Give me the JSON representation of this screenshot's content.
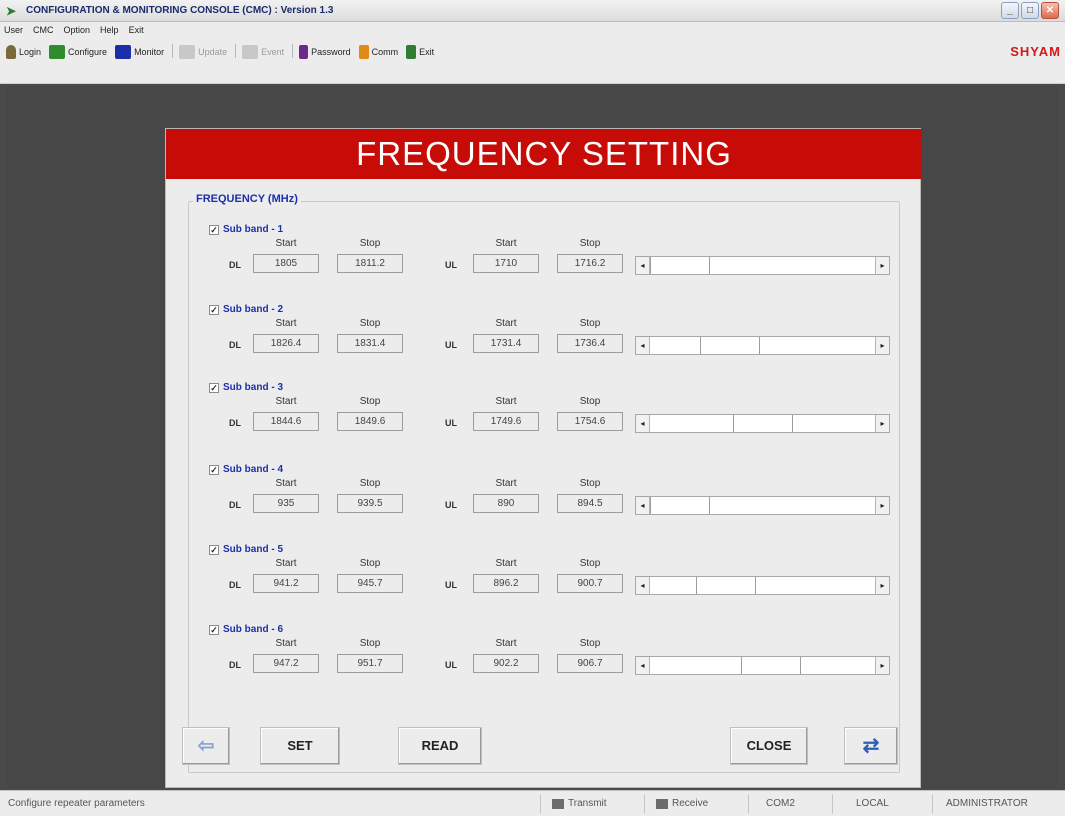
{
  "window": {
    "title": "CONFIGURATION & MONITORING CONSOLE (CMC) : Version 1.3"
  },
  "menu": [
    "User",
    "CMC",
    "Option",
    "Help",
    "Exit"
  ],
  "toolbar": {
    "items": [
      {
        "label": "Login",
        "icon": "person-icon",
        "color": "#7a6a3a"
      },
      {
        "label": "Configure",
        "icon": "configure-icon",
        "color": "#2e8b2e"
      },
      {
        "label": "Monitor",
        "icon": "monitor-icon",
        "color": "#1c2fa8"
      },
      {
        "label": "Update",
        "icon": "update-icon",
        "disabled": true
      },
      {
        "label": "Event",
        "icon": "event-icon",
        "disabled": true
      },
      {
        "label": "Password",
        "icon": "password-icon",
        "color": "#6a2a8a"
      },
      {
        "label": "Comm",
        "icon": "comm-icon",
        "color": "#e08a1a"
      },
      {
        "label": "Exit",
        "icon": "exit-icon",
        "color": "#2e7d32"
      }
    ],
    "brand": "SHYAM"
  },
  "dialog": {
    "title": "FREQUENCY SETTING",
    "group_label": "FREQUENCY (MHz)",
    "col_start": "Start",
    "col_stop": "Stop",
    "dl_label": "DL",
    "ul_label": "UL",
    "bands": [
      {
        "name": "Sub band - 1",
        "checked": true,
        "dl_start": "1805",
        "dl_stop": "1811.2",
        "ul_start": "1710",
        "ul_stop": "1716.2",
        "slider_fraction": 0.0
      },
      {
        "name": "Sub band - 2",
        "checked": true,
        "dl_start": "1826.4",
        "dl_stop": "1831.4",
        "ul_start": "1731.4",
        "ul_stop": "1736.4",
        "slider_fraction": 0.3
      },
      {
        "name": "Sub band - 3",
        "checked": true,
        "dl_start": "1844.6",
        "dl_stop": "1849.6",
        "ul_start": "1749.6",
        "ul_stop": "1754.6",
        "slider_fraction": 0.5
      },
      {
        "name": "Sub band - 4",
        "checked": true,
        "dl_start": "935",
        "dl_stop": "939.5",
        "ul_start": "890",
        "ul_stop": "894.5",
        "slider_fraction": 0.0
      },
      {
        "name": "Sub band - 5",
        "checked": true,
        "dl_start": "941.2",
        "dl_stop": "945.7",
        "ul_start": "896.2",
        "ul_stop": "900.7",
        "slider_fraction": 0.28
      },
      {
        "name": "Sub band - 6",
        "checked": true,
        "dl_start": "947.2",
        "dl_stop": "951.7",
        "ul_start": "902.2",
        "ul_stop": "906.7",
        "slider_fraction": 0.55
      }
    ],
    "set_label": "SET",
    "read_label": "READ",
    "close_label": "CLOSE"
  },
  "status": {
    "message": "Configure repeater parameters",
    "transmit": "Transmit",
    "receive": "Receive",
    "port": "COM2",
    "mode": "LOCAL",
    "user": "ADMINISTRATOR"
  }
}
